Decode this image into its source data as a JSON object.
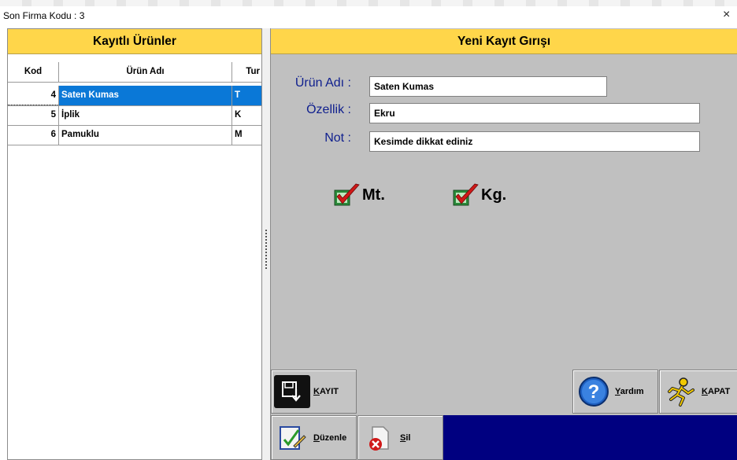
{
  "window": {
    "title": "Son Firma Kodu : 3",
    "close_glyph": "×"
  },
  "left_panel": {
    "header": "Kayıtlı Ürünler",
    "columns": [
      "Kod",
      "Ürün Adı",
      "Tur"
    ],
    "rows": [
      {
        "kod": "4",
        "ad": "Saten Kumas",
        "tur": "T",
        "selected": true
      },
      {
        "kod": "5",
        "ad": "İplik",
        "tur": "K",
        "selected": false
      },
      {
        "kod": "6",
        "ad": "Pamuklu",
        "tur": "M",
        "selected": false
      }
    ]
  },
  "right_panel": {
    "header": "Yeni Kayıt Gırışı",
    "fields": {
      "urun_adi": {
        "label": "Ürün Adı :",
        "value": "Saten Kumas"
      },
      "ozellik": {
        "label": "Özellik :",
        "value": "Ekru"
      },
      "not": {
        "label": "Not :",
        "value": "Kesimde dikkat ediniz"
      }
    },
    "checks": [
      {
        "label": "Mt.",
        "checked": true
      },
      {
        "label": "Kg.",
        "checked": true
      }
    ]
  },
  "buttons": {
    "kayit": "KAYIT",
    "yardim": "Yardım",
    "kapat": "KAPAT",
    "duzenle": "Düzenle",
    "sil": "Sil"
  },
  "colors": {
    "header_yellow": "#ffd64a",
    "selection_blue": "#0a78d7",
    "label_navy": "#10208e",
    "panel_gray": "#c0c0c0",
    "footer_navy": "#000080"
  }
}
